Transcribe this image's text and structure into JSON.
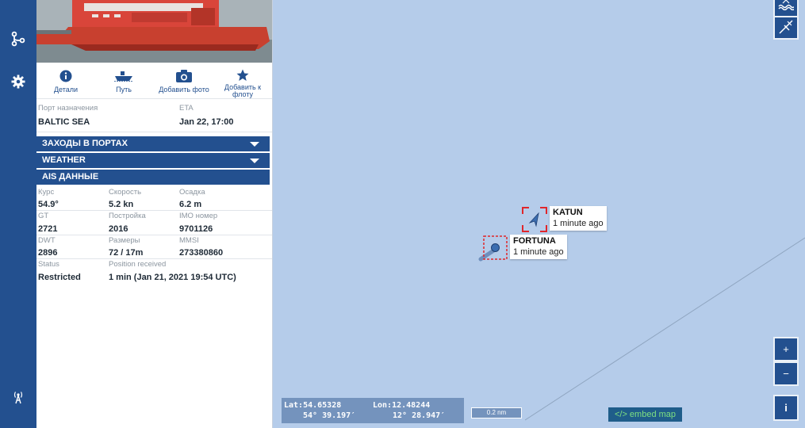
{
  "actions": [
    {
      "label": "Детали",
      "icon": "info-icon"
    },
    {
      "label": "Путь",
      "icon": "route-ship-icon"
    },
    {
      "label": "Добавить фото",
      "icon": "camera-icon"
    },
    {
      "label": "Добавить к флоту",
      "icon": "star-icon"
    }
  ],
  "voyage": {
    "dest_label": "Порт назначения",
    "dest_value": "BALTIC SEA",
    "eta_label": "ETA",
    "eta_value": "Jan 22, 17:00"
  },
  "sections": {
    "port_calls": "ЗАХОДЫ В ПОРТАХ",
    "weather": "WEATHER",
    "ais": "AIS ДАННЫЕ"
  },
  "ais": {
    "course_label": "Курс",
    "course_value": "54.9°",
    "speed_label": "Скорость",
    "speed_value": "5.2 kn",
    "draught_label": "Осадка",
    "draught_value": "6.2 m",
    "gt_label": "GT",
    "gt_value": "2721",
    "built_label": "Постройка",
    "built_value": "2016",
    "imo_label": "IMO номер",
    "imo_value": "9701126",
    "dwt_label": "DWT",
    "dwt_value": "2896",
    "size_label": "Размеры",
    "size_value": "72 / 17m",
    "mmsi_label": "MMSI",
    "mmsi_value": "273380860",
    "status_label": "Status",
    "status_value": "Restricted",
    "posrec_label": "Position received",
    "posrec_value": "1 min (Jan 21, 2021 19:54 UTC)"
  },
  "map": {
    "ships": [
      {
        "name": "KATUN",
        "time": "1 minute ago"
      },
      {
        "name": "FORTUNA",
        "time": "1 minute ago"
      }
    ],
    "lat_label": "Lat:54.65328",
    "lon_label": "Lon:12.48244",
    "lat_dms": "54° 39.197′",
    "lon_dms": "12° 28.947′",
    "scale": "0.2 nm",
    "embed": "</> embed map",
    "zoom_in": "+",
    "zoom_out": "−",
    "info": "i"
  },
  "colors": {
    "primary": "#23508f",
    "sea": "#b5ccea",
    "target_box": "#e0262b",
    "embed_text": "#7ee081"
  }
}
